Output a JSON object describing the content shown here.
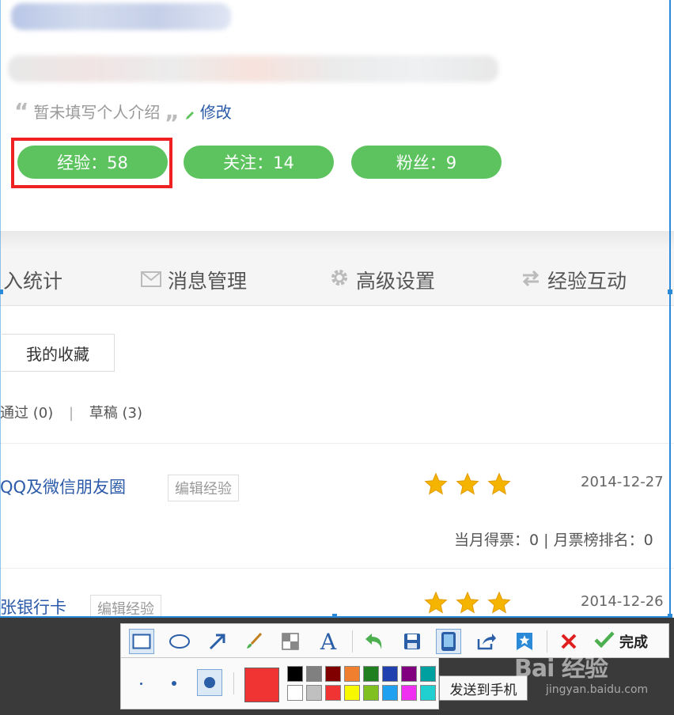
{
  "profile": {
    "bio_open_quote": "“",
    "bio_text": "暂未填写个人介绍",
    "bio_close_quote": "„",
    "edit_label": "修改",
    "stats": [
      {
        "label": "经验：58"
      },
      {
        "label": "关注：14"
      },
      {
        "label": "粉丝：9"
      }
    ]
  },
  "nav": {
    "items": [
      {
        "label": "入统计",
        "icon": ""
      },
      {
        "label": "消息管理",
        "icon": "mail-icon"
      },
      {
        "label": "高级设置",
        "icon": "gear-icon"
      },
      {
        "label": "经验互动",
        "icon": "swap-icon"
      }
    ]
  },
  "main": {
    "tab_label": "我的收藏",
    "filters": {
      "passed": "通过 (0)",
      "separator": "|",
      "drafts": "草稿 (3)"
    },
    "rows": [
      {
        "title": "QQ及微信朋友圈",
        "edit_tag": "编辑经验",
        "stars": 3,
        "date": "2014-12-27",
        "vote": "当月得票：0 | 月票榜排名：0"
      },
      {
        "title": "张银行卡",
        "edit_tag": "编辑经验",
        "stars": 3,
        "date": "2014-12-26"
      }
    ]
  },
  "toolbar": {
    "done_label": "完成",
    "tooltip": "发送到手机",
    "selected_color": "#f03434",
    "palette_top": [
      "#000000",
      "#808080",
      "#800000",
      "#f08030",
      "#208020",
      "#2040b0",
      "#800080",
      "#00a0a0"
    ],
    "palette_bottom": [
      "#ffffff",
      "#c0c0c0",
      "#f03434",
      "#f8f800",
      "#80c020",
      "#20a0f0",
      "#f030f0",
      "#20d0d0"
    ]
  },
  "watermark": {
    "logo": "Bai  经验",
    "url": "jingyan.baidu.com"
  },
  "colors": {
    "accent_green": "#5cc35e",
    "link_blue": "#2b5aa8",
    "highlight_red": "#e22222",
    "selection_blue": "#2a8ad8"
  }
}
